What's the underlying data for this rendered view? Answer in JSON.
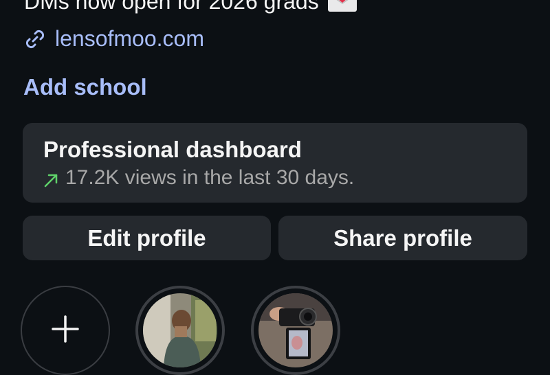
{
  "profile": {
    "bio_line": "DMs now open for 2026 grads",
    "link": "lensofmoo.com",
    "add_school": "Add school"
  },
  "dashboard": {
    "title": "Professional dashboard",
    "stats": "17.2K views in the last 30 days."
  },
  "buttons": {
    "edit": "Edit profile",
    "share": "Share profile"
  },
  "highlights": {
    "new_icon": "plus-icon",
    "items": [
      "photo-person-window",
      "photo-camera-hand"
    ]
  },
  "colors": {
    "background": "#0c1014",
    "card": "#25292e",
    "link": "#a8bdf9",
    "trend": "#5fd16a",
    "muted": "#a8a8a8"
  }
}
